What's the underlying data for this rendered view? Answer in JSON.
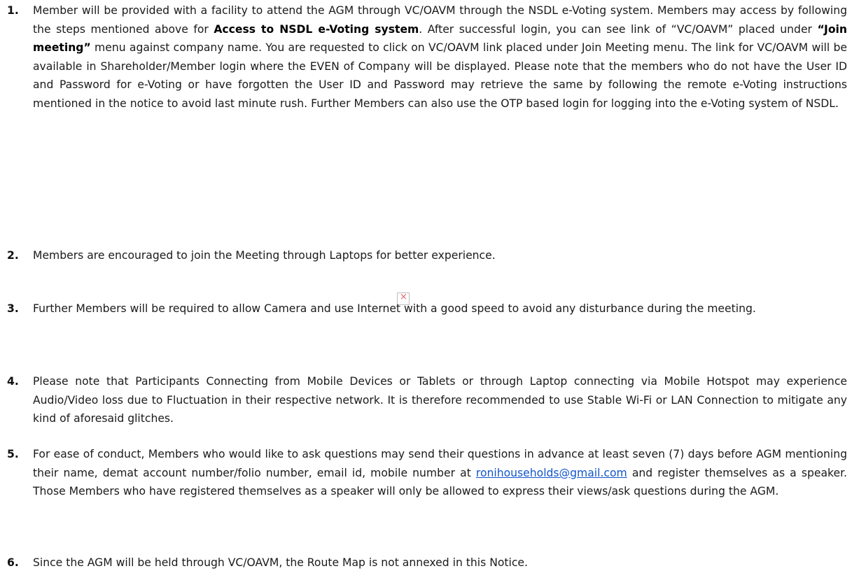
{
  "items": [
    {
      "number": "1.",
      "text_a": "Member will be provided with a facility to attend the AGM through VC/OAVM through the NSDL e-Voting system. Members may access by following the steps mentioned above for ",
      "bold_a": "Access to NSDL e-Voting system",
      "text_b": ". After successful login, you can see link of “VC/OAVM” placed under ",
      "bold_b": "“Join meeting”",
      "text_c": " menu against company name. You are requested to click on VC/OAVM link placed under Join Meeting menu. The link for VC/OAVM will be available in Shareholder/Member login where the EVEN of Company will be displayed. Please note that the members who do not have the User ID and Password for e-Voting or have forgotten the User ID and Password may retrieve the same by following the remote e-Voting instructions mentioned in the notice to avoid last minute rush. Further Members can also use the OTP based login for logging into the e-Voting system of NSDL."
    },
    {
      "number": "2.",
      "text": "Members are encouraged to join the Meeting through Laptops for better experience."
    },
    {
      "number": "3.",
      "text": "Further Members will be required to allow Camera and use Internet with a good speed to avoid any disturbance during the meeting."
    },
    {
      "number": "4.",
      "text": "Please note that Participants Connecting from Mobile Devices or Tablets or through Laptop connecting via Mobile Hotspot may experience Audio/Video loss due to Fluctuation in their respective network. It is therefore recommended to use Stable Wi-Fi or LAN Connection to mitigate any kind of aforesaid glitches."
    },
    {
      "number": "5.",
      "text_a": "For ease of conduct, Members who would like to ask questions may send their questions in advance at least seven (7) days before AGM mentioning their name, demat account number/folio number, email id, mobile number at ",
      "link": "ronihouseholds@gmail.com",
      "text_b": " and register themselves as a speaker. Those Members who have registered themselves as a speaker will only be allowed to express their views/ask questions during the AGM."
    },
    {
      "number": "6.",
      "text": "Since the AGM will be held through VC/OAVM, the Route Map is not annexed in this Notice."
    }
  ],
  "broken_image_glyph": "×"
}
